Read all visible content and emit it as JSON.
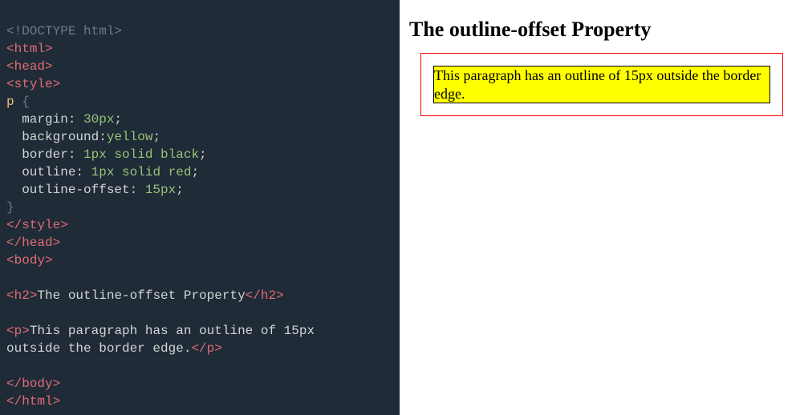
{
  "code": {
    "l01": "<!DOCTYPE html>",
    "l02a": "<",
    "l02b": "html",
    "l02c": ">",
    "l03a": "<",
    "l03b": "head",
    "l03c": ">",
    "l04a": "<",
    "l04b": "style",
    "l04c": ">",
    "sel": "p ",
    "brace_open": "{",
    "p1k": "  margin",
    "p1c": ": ",
    "p1v": "30px",
    "p1s": ";",
    "p2k": "  background",
    "p2c": ":",
    "p2v": "yellow",
    "p2s": ";",
    "p3k": "  border",
    "p3c": ": ",
    "p3v": "1px solid black",
    "p3s": ";",
    "p4k": "  outline",
    "p4c": ": ",
    "p4v": "1px solid red",
    "p4s": ";",
    "p5k": "  outline-offset",
    "p5c": ": ",
    "p5v": "15px",
    "p5s": ";",
    "brace_close": "}",
    "l_end_style_a": "</",
    "l_end_style_b": "style",
    "l_end_style_c": ">",
    "l_end_head_a": "</",
    "l_end_head_b": "head",
    "l_end_head_c": ">",
    "l_body_a": "<",
    "l_body_b": "body",
    "l_body_c": ">",
    "h2_open_a": "<",
    "h2_open_b": "h2",
    "h2_open_c": ">",
    "h2_text": "The outline-offset Property",
    "h2_close_a": "</",
    "h2_close_b": "h2",
    "h2_close_c": ">",
    "p_open_a": "<",
    "p_open_b": "p",
    "p_open_c": ">",
    "p_text1": "This paragraph has an outline of 15px ",
    "p_text2": "outside the border edge.",
    "p_close_a": "</",
    "p_close_b": "p",
    "p_close_c": ">",
    "l_end_body_a": "</",
    "l_end_body_b": "body",
    "l_end_body_c": ">",
    "l_end_html_a": "</",
    "l_end_html_b": "html",
    "l_end_html_c": ">"
  },
  "preview": {
    "heading": "The outline-offset Property",
    "paragraph": "This paragraph has an outline of 15px outside the border edge."
  }
}
